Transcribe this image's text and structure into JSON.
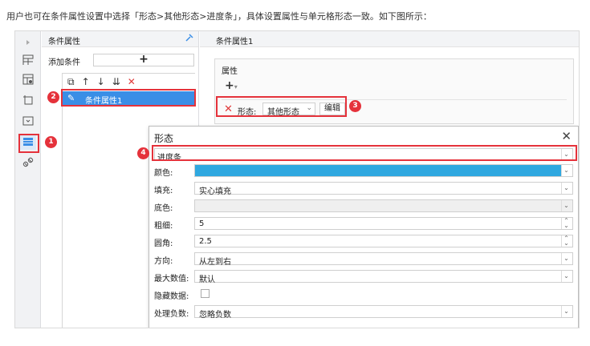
{
  "intro": {
    "text": "用户也可在条件属性设置中选择「形态>其他形态>进度条」，具体设置属性与单元格形态一致。如下图所示："
  },
  "icon_bar": {
    "items": [
      {
        "name": "expand-arrow-icon"
      },
      {
        "name": "cell-element-icon"
      },
      {
        "name": "cell-attribute-icon"
      },
      {
        "name": "widget-settings-icon"
      },
      {
        "name": "dropdown-widget-icon"
      },
      {
        "name": "condition-attribute-icon",
        "active": true
      },
      {
        "name": "hyperlink-icon"
      }
    ]
  },
  "condition_panel": {
    "title": "条件属性",
    "pin_icon": "pin-icon",
    "add_condition_label": "添加条件",
    "add_button": "+",
    "toolbar": {
      "copy_icon": "⧉",
      "up_icon": "↑",
      "down_icon": "↓",
      "import_icon": "⇊",
      "delete_icon": "✕"
    },
    "items": [
      {
        "label": "条件属性1",
        "icon": "pencil-icon",
        "selected": true
      }
    ]
  },
  "property_panel": {
    "title": "条件属性1",
    "group_label": "属性",
    "add_button": "+",
    "add_button_caret": "▾",
    "shape_row": {
      "remove_icon": "✕",
      "label": "形态:",
      "select_value": "其他形态",
      "select_caret": "⌄",
      "edit_button": "编辑"
    }
  },
  "shape_dialog": {
    "title": "形态",
    "close_icon": "✕",
    "type_value": "进度条",
    "fields": [
      {
        "label": "颜色:",
        "kind": "color",
        "value": "",
        "color": "#2fa8e0"
      },
      {
        "label": "填充:",
        "kind": "select",
        "value": "实心填充"
      },
      {
        "label": "底色:",
        "kind": "select-disabled",
        "value": ""
      },
      {
        "label": "粗细:",
        "kind": "spinner",
        "value": "5"
      },
      {
        "label": "圆角:",
        "kind": "spinner",
        "value": "2.5"
      },
      {
        "label": "方向:",
        "kind": "select",
        "value": "从左到右"
      },
      {
        "label": "最大数值:",
        "kind": "select",
        "value": "默认"
      },
      {
        "label": "隐藏数据:",
        "kind": "checkbox",
        "value": ""
      },
      {
        "label": "处理负数:",
        "kind": "select",
        "value": "忽略负数"
      }
    ]
  },
  "annotations": {
    "badges": [
      "1",
      "2",
      "3",
      "4"
    ],
    "highlight_color": "#e5323b"
  },
  "colors": {
    "accent": "#3a8ee6",
    "progress_color": "#2fa8e0",
    "annotation": "#e5323b"
  }
}
